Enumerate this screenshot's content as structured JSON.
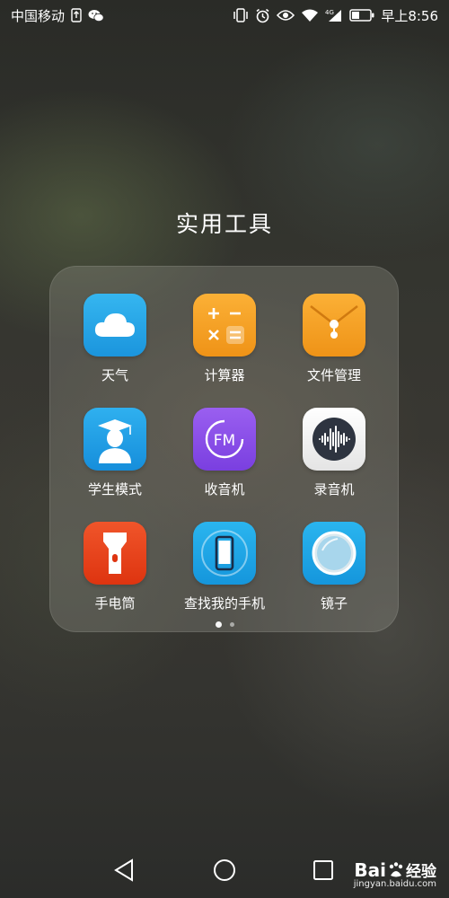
{
  "status_bar": {
    "carrier": "中国移动",
    "network": "4G",
    "time": "早上8:56"
  },
  "folder": {
    "title": "实用工具",
    "apps": [
      {
        "label": "天气",
        "icon": "weather-cloud-icon",
        "color": "#29a8e8"
      },
      {
        "label": "计算器",
        "icon": "calculator-icon",
        "color": "#f5a023"
      },
      {
        "label": "文件管理",
        "icon": "file-manager-envelope-icon",
        "color": "#f5a023"
      },
      {
        "label": "学生模式",
        "icon": "student-graduate-icon",
        "color": "#1f9de3"
      },
      {
        "label": "收音机",
        "icon": "radio-fm-icon",
        "color": "#8a4fe8"
      },
      {
        "label": "录音机",
        "icon": "recorder-waveform-icon",
        "color": "#f2f2f2"
      },
      {
        "label": "手电筒",
        "icon": "flashlight-icon",
        "color": "#e8401c"
      },
      {
        "label": "查找我的手机",
        "icon": "find-phone-icon",
        "color": "#1fa9e6"
      },
      {
        "label": "镜子",
        "icon": "mirror-icon",
        "color": "#1fa9e6"
      }
    ],
    "page_count": 2,
    "current_page": 1
  },
  "watermark": {
    "brand": "Bai",
    "brand_suffix": "经验",
    "url": "jingyan.baidu.com"
  }
}
